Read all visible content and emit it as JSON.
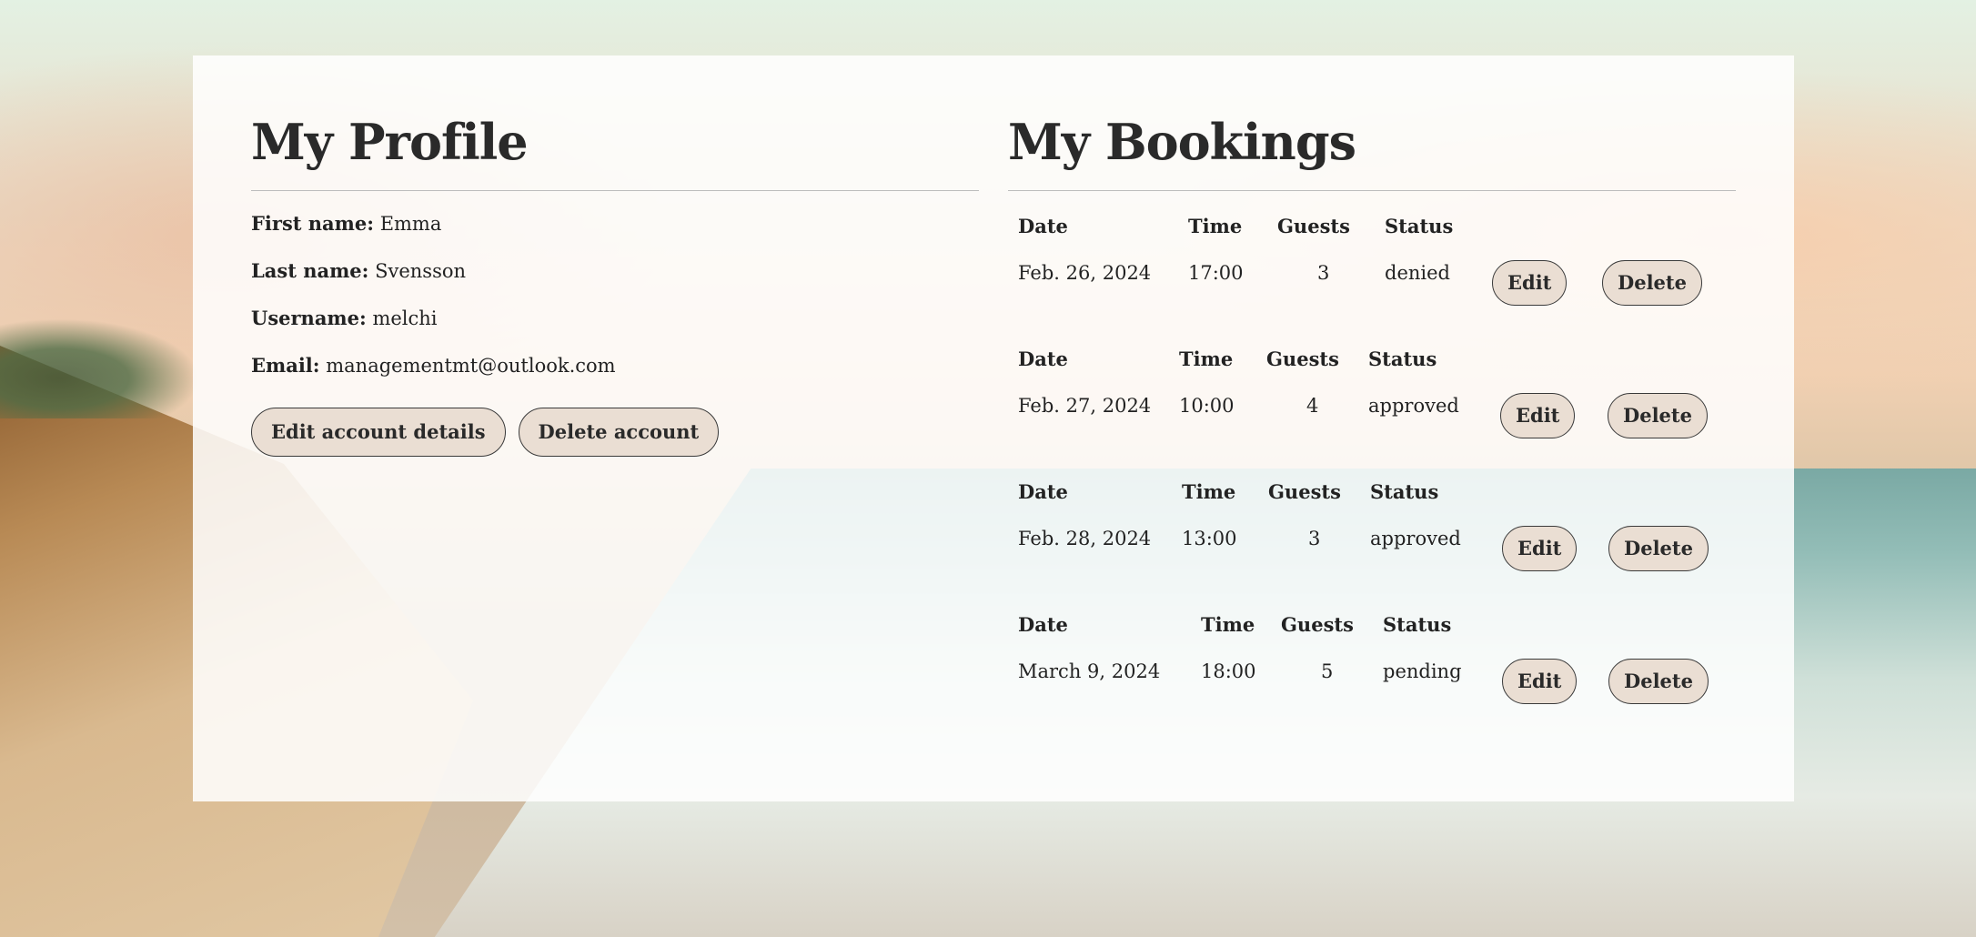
{
  "profile": {
    "title": "My Profile",
    "first_name_label": "First name:",
    "first_name": "Emma",
    "last_name_label": "Last name:",
    "last_name": "Svensson",
    "username_label": "Username:",
    "username": "melchi",
    "email_label": "Email:",
    "email": "managementmt@outlook.com",
    "edit_button": "Edit account details",
    "delete_button": "Delete account"
  },
  "bookings": {
    "title": "My Bookings",
    "headers": {
      "date": "Date",
      "time": "Time",
      "guests": "Guests",
      "status": "Status"
    },
    "edit_label": "Edit",
    "delete_label": "Delete",
    "items": [
      {
        "date": "Feb. 26, 2024",
        "time": "17:00",
        "guests": "3",
        "status": "denied"
      },
      {
        "date": "Feb. 27, 2024",
        "time": "10:00",
        "guests": "4",
        "status": "approved"
      },
      {
        "date": "Feb. 28, 2024",
        "time": "13:00",
        "guests": "3",
        "status": "approved"
      },
      {
        "date": "March 9, 2024",
        "time": "18:00",
        "guests": "5",
        "status": "pending"
      }
    ]
  },
  "colors": {
    "card_background": "#ffffff",
    "button_background": "#eaded3",
    "button_border": "#3a3a3a",
    "text": "#222222",
    "divider": "#bdbdbd"
  }
}
